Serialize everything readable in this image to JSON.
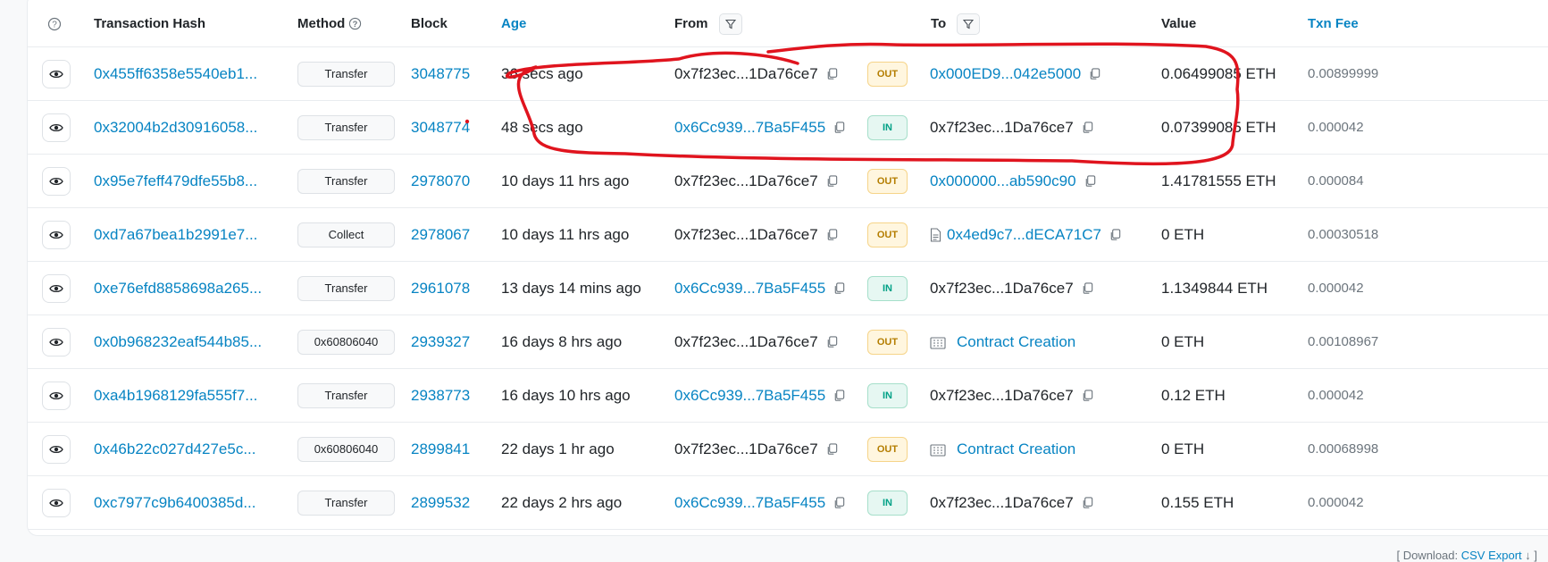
{
  "headers": {
    "transaction_hash": "Transaction Hash",
    "method": "Method",
    "block": "Block",
    "age": "Age",
    "from": "From",
    "to": "To",
    "value": "Value",
    "txn_fee": "Txn Fee"
  },
  "rows": [
    {
      "hash": "0x455ff6358e5540eb1...",
      "method": "Transfer",
      "block": "3048775",
      "age": "36 secs ago",
      "from": "0x7f23ec...1Da76ce7",
      "from_link": false,
      "direction": "OUT",
      "to": "0x000ED9...042e5000",
      "to_link": true,
      "to_icon": "",
      "value": "0.06499085 ETH",
      "fee": "0.00899999"
    },
    {
      "hash": "0x32004b2d30916058...",
      "method": "Transfer",
      "block": "3048774",
      "age": "48 secs ago",
      "from": "0x6Cc939...7Ba5F455",
      "from_link": true,
      "direction": "IN",
      "to": "0x7f23ec...1Da76ce7",
      "to_link": false,
      "to_icon": "",
      "value": "0.07399085 ETH",
      "fee": "0.000042"
    },
    {
      "hash": "0x95e7feff479dfe55b8...",
      "method": "Transfer",
      "block": "2978070",
      "age": "10 days 11 hrs ago",
      "from": "0x7f23ec...1Da76ce7",
      "from_link": false,
      "direction": "OUT",
      "to": "0x000000...ab590c90",
      "to_link": true,
      "to_icon": "",
      "value": "1.41781555 ETH",
      "fee": "0.000084"
    },
    {
      "hash": "0xd7a67bea1b2991e7...",
      "method": "Collect",
      "block": "2978067",
      "age": "10 days 11 hrs ago",
      "from": "0x7f23ec...1Da76ce7",
      "from_link": false,
      "direction": "OUT",
      "to": "0x4ed9c7...dECA71C7",
      "to_link": true,
      "to_icon": "file-icon",
      "value": "0 ETH",
      "fee": "0.00030518"
    },
    {
      "hash": "0xe76efd8858698a265...",
      "method": "Transfer",
      "block": "2961078",
      "age": "13 days 14 mins ago",
      "from": "0x6Cc939...7Ba5F455",
      "from_link": true,
      "direction": "IN",
      "to": "0x7f23ec...1Da76ce7",
      "to_link": false,
      "to_icon": "",
      "value": "1.1349844 ETH",
      "fee": "0.000042"
    },
    {
      "hash": "0x0b968232eaf544b85...",
      "method": "0x60806040",
      "block": "2939327",
      "age": "16 days 8 hrs ago",
      "from": "0x7f23ec...1Da76ce7",
      "from_link": false,
      "direction": "OUT",
      "to": "Contract Creation",
      "to_link": true,
      "to_icon": "building-icon",
      "value": "0 ETH",
      "fee": "0.00108967"
    },
    {
      "hash": "0xa4b1968129fa555f7...",
      "method": "Transfer",
      "block": "2938773",
      "age": "16 days 10 hrs ago",
      "from": "0x6Cc939...7Ba5F455",
      "from_link": true,
      "direction": "IN",
      "to": "0x7f23ec...1Da76ce7",
      "to_link": false,
      "to_icon": "",
      "value": "0.12 ETH",
      "fee": "0.000042"
    },
    {
      "hash": "0x46b22c027d427e5c...",
      "method": "0x60806040",
      "block": "2899841",
      "age": "22 days 1 hr ago",
      "from": "0x7f23ec...1Da76ce7",
      "from_link": false,
      "direction": "OUT",
      "to": "Contract Creation",
      "to_link": true,
      "to_icon": "building-icon",
      "value": "0 ETH",
      "fee": "0.00068998"
    },
    {
      "hash": "0xc7977c9b6400385d...",
      "method": "Transfer",
      "block": "2899532",
      "age": "22 days 2 hrs ago",
      "from": "0x6Cc939...7Ba5F455",
      "from_link": true,
      "direction": "IN",
      "to": "0x7f23ec...1Da76ce7",
      "to_link": false,
      "to_icon": "",
      "value": "0.155 ETH",
      "fee": "0.000042"
    }
  ],
  "footer": {
    "prefix": "[ Download: ",
    "link": "CSV Export",
    "suffix": " ↓ ]"
  },
  "colors": {
    "link": "#0784c3",
    "out_badge": "#b47d00",
    "in_badge": "#00a186",
    "annotation": "#e0141e"
  }
}
